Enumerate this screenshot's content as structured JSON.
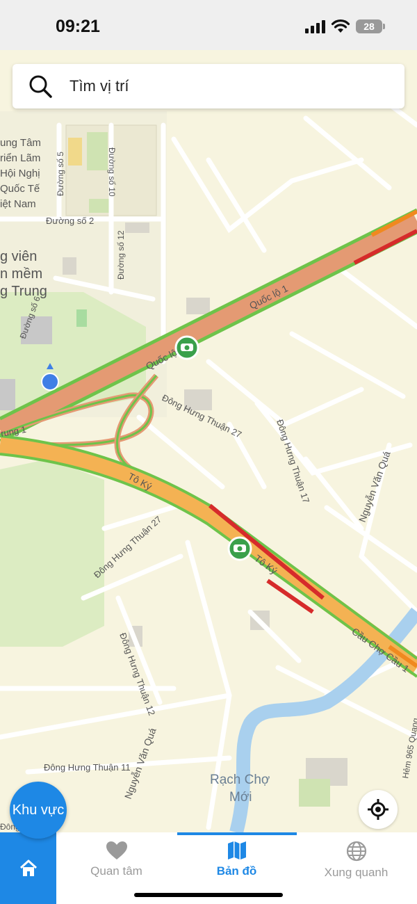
{
  "status_bar": {
    "time": "09:21",
    "battery": "28"
  },
  "search": {
    "placeholder": "Tìm vị trí"
  },
  "map": {
    "labels": {
      "trung_tam": "ung Tâm",
      "trien_lam": "riển Lãm",
      "hoi_nghi": "Hội Nghị",
      "quoc_te": "Quốc Tế",
      "viet_nam": "iệt Nam",
      "duong_so_5": "Đường số 5",
      "duong_so_10": "Đường số 10",
      "duong_so_2": "Đường số 2",
      "duong_so_12": "Đường số 12",
      "duong_so_6": "Đường số 6",
      "cong_vien": "g viên",
      "phan_mem": "n mềm",
      "quang_trung": "g Trung",
      "quoc_lo_1a": "Quốc lộ 1",
      "quoc_lo_1b": "Quốc lộ 1",
      "dong_hung_thuan_27a": "Đông Hưng Thuận 27",
      "dong_hung_thuan_17": "Đông Hưng Thuận 17",
      "nguyen_van_qua_a": "Nguyễn Văn Quá",
      "trung_left": "rung 1",
      "to_ky_a": "Tô Ký",
      "to_ky_b": "Tô Ký",
      "dong_hung_thuan_27b": "Đông Hưng Thuận 27",
      "dong_hung_thuan_12": "Đông Hưng Thuận 12",
      "cau_cho_cau": "Cầu Chợ Cầu 1",
      "dong_hung_thuan_11": "Đông Hưng Thuận 11",
      "nguyen_van_qua_b": "Nguyễn Văn Quá",
      "rach_cho": "Rạch Chợ",
      "moi": "Mới",
      "hem_965": "Hẻm 965 Quang",
      "dong_bottom": "Đông"
    }
  },
  "area_button": {
    "label": "Khu vực"
  },
  "tabs": [
    {
      "label": "Quan tâm"
    },
    {
      "label": "Bản đồ"
    },
    {
      "label": "Xung quanh"
    }
  ],
  "colors": {
    "accent": "#1e88e5",
    "traffic_green": "#6ec34a",
    "traffic_red": "#d62b2b",
    "traffic_orange": "#f0891f",
    "road_orange": "#f4b253",
    "road_salmon": "#e49a73",
    "water": "#a9d0ee",
    "park": "#dcecc2"
  }
}
